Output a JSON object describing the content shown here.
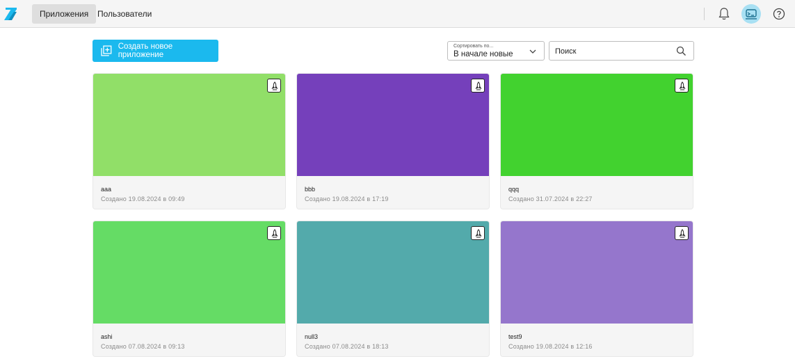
{
  "nav": {
    "tabs": [
      {
        "label": "Приложения",
        "active": true
      },
      {
        "label": "Пользователи",
        "active": false
      }
    ],
    "icons": {
      "logo": "logo-icon",
      "notifications": "bell-icon",
      "avatar": "avatar-icon",
      "help": "help-icon"
    }
  },
  "toolbar": {
    "create_label": "Создать новое приложение",
    "sort_label": "Сортировать по...",
    "sort_value": "В начале новые",
    "search_placeholder": "Поиск"
  },
  "colors": {
    "accent": "#1bb9ee"
  },
  "apps": [
    {
      "name": "aaa",
      "created": "Создано 19.08.2024 в 09:49",
      "color": "#91df68"
    },
    {
      "name": "bbb",
      "created": "Создано 19.08.2024 в 17:19",
      "color": "#7540bb"
    },
    {
      "name": "qqq",
      "created": "Создано 31.07.2024 в 22:27",
      "color": "#42d22f"
    },
    {
      "name": "ashi",
      "created": "Создано 07.08.2024 в 09:13",
      "color": "#65dc65"
    },
    {
      "name": "null3",
      "created": "Создано 07.08.2024 в 18:13",
      "color": "#53aaab"
    },
    {
      "name": "test9",
      "created": "Создано 19.08.2024 в 12:16",
      "color": "#9576cc"
    }
  ]
}
